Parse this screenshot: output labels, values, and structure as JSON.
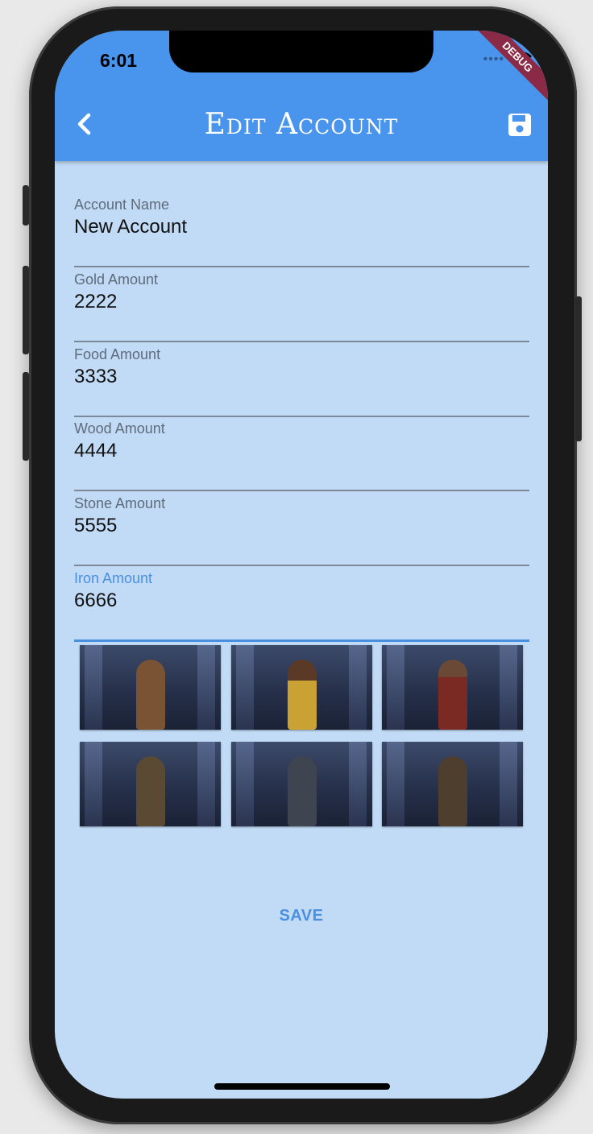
{
  "status": {
    "time": "6:01",
    "debug": "DEBUG"
  },
  "appbar": {
    "title": "Edit Account",
    "back_icon": "chevron-left-icon",
    "save_icon": "floppy-disk-icon"
  },
  "fields": [
    {
      "label": "Account Name",
      "value": "New Account"
    },
    {
      "label": "Gold Amount",
      "value": "2222"
    },
    {
      "label": "Food Amount",
      "value": "3333"
    },
    {
      "label": "Wood Amount",
      "value": "4444"
    },
    {
      "label": "Stone Amount",
      "value": "5555"
    },
    {
      "label": "Iron Amount",
      "value": "6666"
    }
  ],
  "portraits": [
    "portrait-1",
    "portrait-2",
    "portrait-3",
    "portrait-4",
    "portrait-5",
    "portrait-6"
  ],
  "actions": {
    "save_label": "SAVE"
  },
  "colors": {
    "appbar": "#4994ec",
    "background": "#c1dbf6",
    "accent": "#4a8fe0"
  }
}
